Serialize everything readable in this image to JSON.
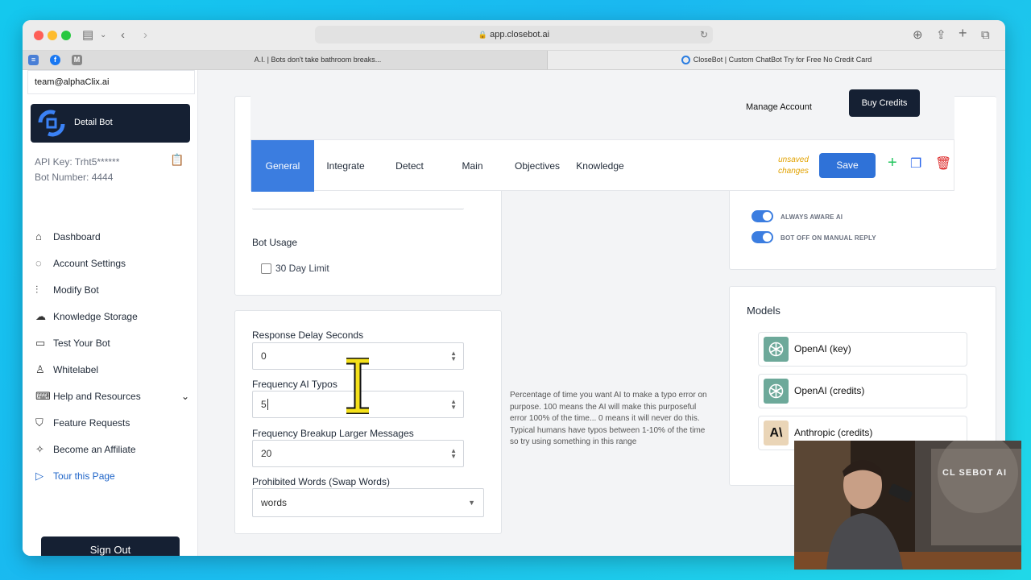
{
  "browser": {
    "url": "app.closebot.ai",
    "tabs": [
      {
        "label": "A.I. | Bots don't take bathroom breaks..."
      },
      {
        "label": "CloseBot | Custom ChatBot Try for Free No Credit Card"
      }
    ]
  },
  "sidebar": {
    "email": "team@alphaClix.ai",
    "bot_button": "Detail Bot",
    "api_key": "API Key: Trht5******",
    "bot_number": "Bot Number: 4444",
    "nav": [
      {
        "label": "Dashboard",
        "icon": "home-icon"
      },
      {
        "label": "Account Settings",
        "icon": "planet-icon"
      },
      {
        "label": "Modify Bot",
        "icon": "sliders-icon"
      },
      {
        "label": "Knowledge Storage",
        "icon": "cloud-upload-icon"
      },
      {
        "label": "Test Your Bot",
        "icon": "chat-icon"
      },
      {
        "label": "Whitelabel",
        "icon": "user-icon"
      },
      {
        "label": "Help and Resources",
        "icon": "keyboard-icon"
      },
      {
        "label": "Feature Requests",
        "icon": "shield-icon"
      },
      {
        "label": "Become an Affiliate",
        "icon": "magic-wand-icon"
      },
      {
        "label": "Tour this Page",
        "icon": "play-icon"
      }
    ],
    "sign_out": "Sign Out"
  },
  "header": {
    "manage_account": "Manage Account",
    "buy_credits": "Buy Credits"
  },
  "tabs": {
    "items": [
      "General",
      "Integrate",
      "Detect",
      "Main",
      "Objectives",
      "Knowledge"
    ],
    "active": "General",
    "unsaved": "unsaved changes",
    "save": "Save"
  },
  "bot_usage": {
    "title": "Bot Usage",
    "limit_label": "30 Day Limit",
    "limit_checked": false
  },
  "settings": {
    "response_delay": {
      "label": "Response Delay Seconds",
      "value": "0"
    },
    "typos": {
      "label": "Frequency AI Typos",
      "value": "5"
    },
    "breakup": {
      "label": "Frequency Breakup Larger Messages",
      "value": "20"
    },
    "prohibited": {
      "label": "Prohibited Words (Swap Words)",
      "value": "words"
    },
    "typo_hint": "Percentage of time you want AI to make a typo error on purpose.  100 means the AI will make this purposeful error 100% of the time... 0 means it will never do this. Typical humans have typos between 1-10% of the time so try using something in this range"
  },
  "toggles": [
    {
      "label": "ALWAYS AWARE AI",
      "on": true
    },
    {
      "label": "BOT OFF ON MANUAL REPLY",
      "on": true
    }
  ],
  "models": {
    "title": "Models",
    "items": [
      {
        "label": "OpenAI (key)",
        "icon": "openai-icon"
      },
      {
        "label": "OpenAI (credits)",
        "icon": "openai-icon"
      },
      {
        "label": "Anthropic (credits)",
        "icon": "anthropic-icon",
        "glyph": "A\\"
      }
    ]
  },
  "webcam": {
    "sign_text": "CL   SEBOT AI"
  }
}
